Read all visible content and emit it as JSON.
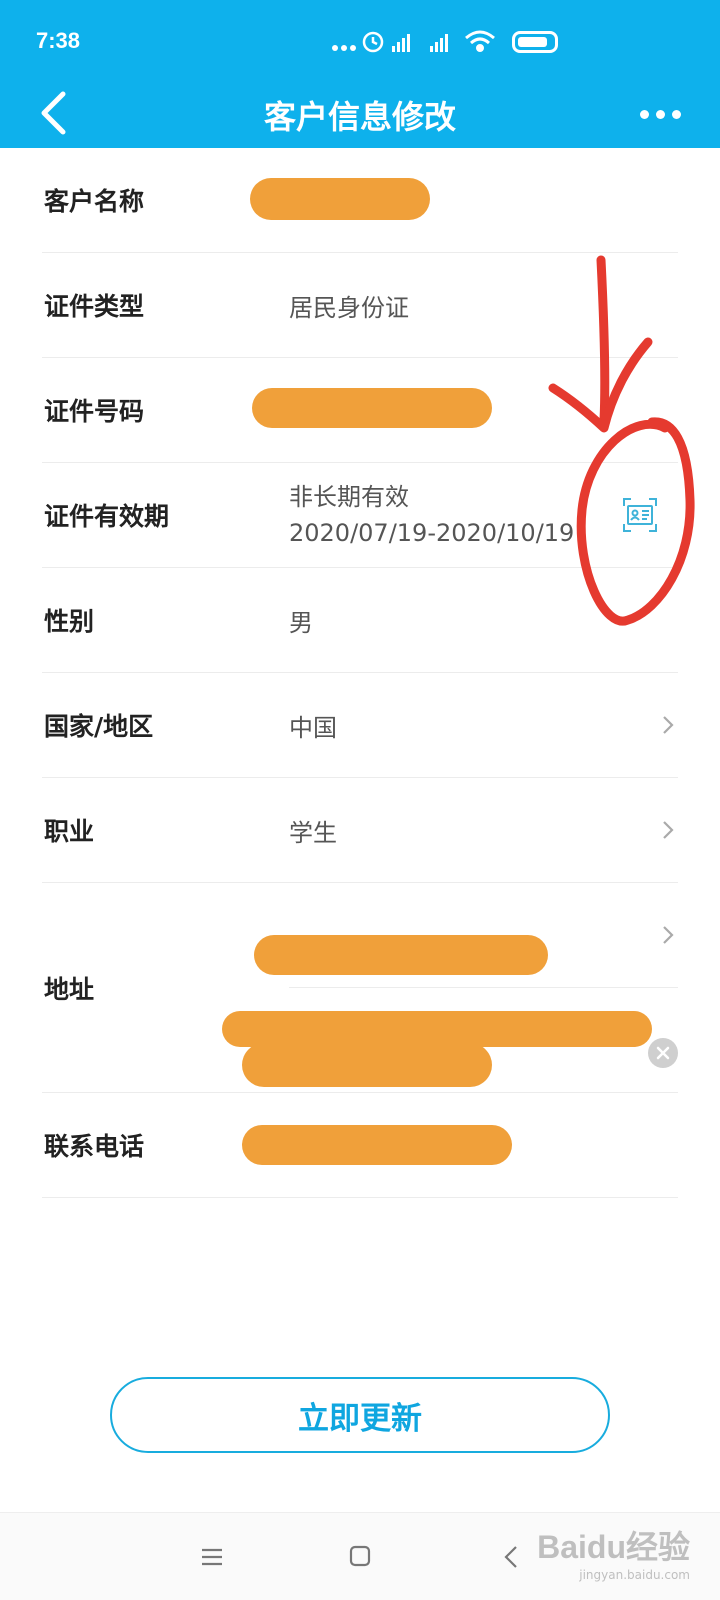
{
  "status_bar": {
    "time": "7:38"
  },
  "header": {
    "title": "客户信息修改"
  },
  "form": {
    "rows": [
      {
        "label": "客户名称",
        "value": ""
      },
      {
        "label": "证件类型",
        "value": "居民身份证"
      },
      {
        "label": "证件号码",
        "value": ""
      },
      {
        "label": "证件有效期",
        "value_line1": "非长期有效",
        "value_line2": "2020/07/19-2020/10/19"
      },
      {
        "label": "性别",
        "value": "男"
      },
      {
        "label": "国家/地区",
        "value": "中国"
      },
      {
        "label": "职业",
        "value": "学生"
      },
      {
        "label": "地址",
        "value": ""
      },
      {
        "label": "联系电话",
        "value": ""
      }
    ]
  },
  "actions": {
    "update_label": "立即更新"
  },
  "watermark": {
    "main": "Baidu经验",
    "sub": "jingyan.baidu.com"
  },
  "colors": {
    "header_bg": "#0eb1ec",
    "button_text": "#0fa6e0",
    "redaction": "#f0a03a",
    "annotation": "#e53a2f"
  }
}
